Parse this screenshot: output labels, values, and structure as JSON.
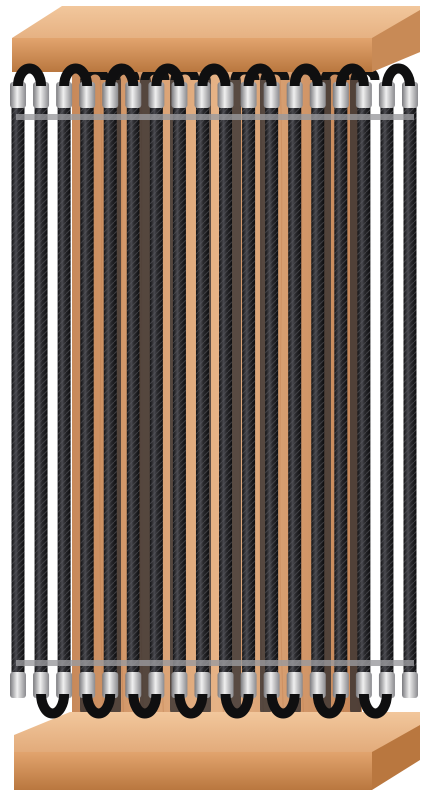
{
  "image": {
    "subject": "carbon-fiber-tube-heat-exchanger",
    "background_color": "#ffffff",
    "colors": {
      "wood_light": "#e9b88a",
      "wood_mid": "#d9a06e",
      "wood_dark": "#b97a4a",
      "tube_dark": "#1b1b1d",
      "tube_mid": "#3a3a3e",
      "tube_highlight": "#6c6c72",
      "metal_light": "#e6e6e6",
      "metal_dark": "#8c8c90",
      "elbow_black": "#0f0f10"
    },
    "front_tube_count": 18,
    "back_tube_count": 10
  }
}
